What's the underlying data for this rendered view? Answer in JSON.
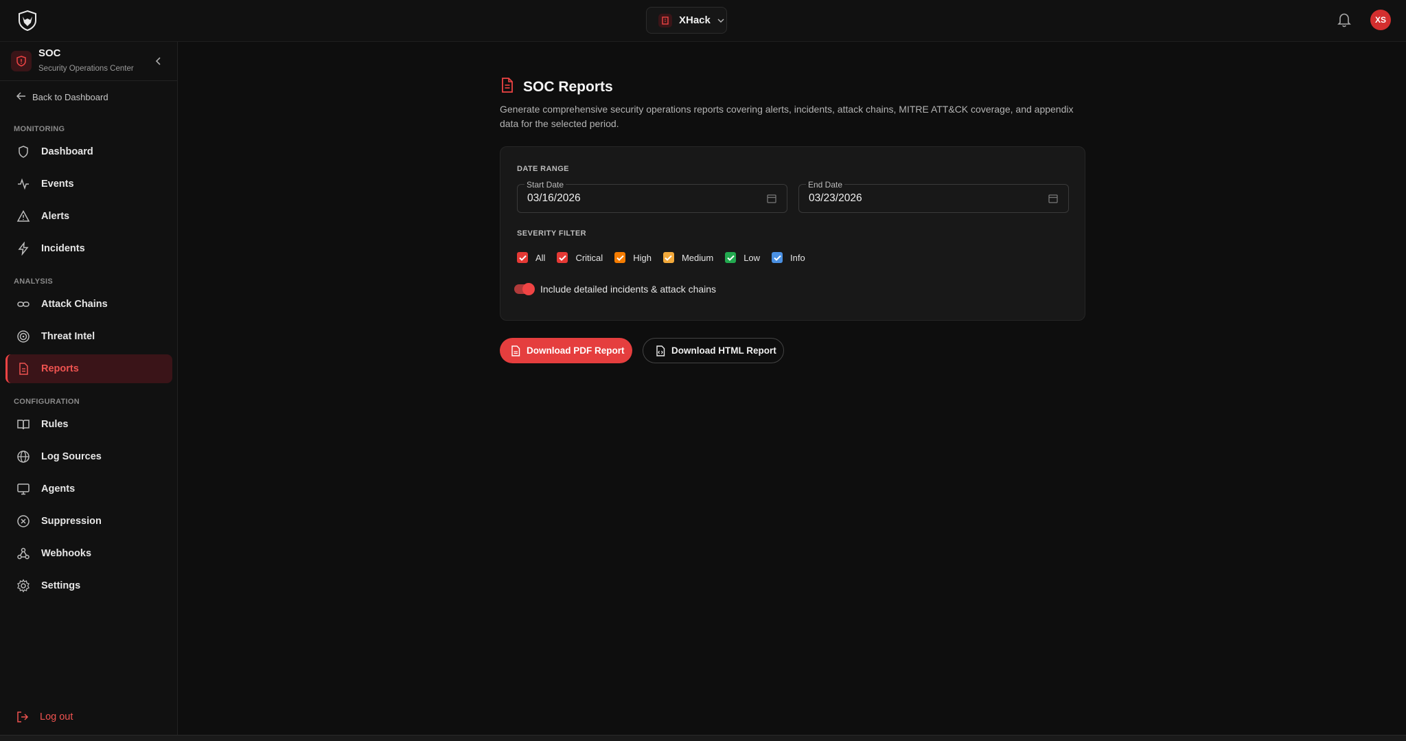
{
  "topbar": {
    "logo_icon": "wolf-shield-logo",
    "tenant_name": "XHack",
    "tenant_icon": "building-icon",
    "notification_icon": "bell-icon",
    "avatar_initials": "XS"
  },
  "sidebar": {
    "app_title": "SOC",
    "app_subtitle": "Security Operations Center",
    "back_label": "Back to Dashboard",
    "sections": [
      {
        "label": "MONITORING",
        "items": [
          {
            "label": "Dashboard",
            "icon": "shield-icon"
          },
          {
            "label": "Events",
            "icon": "activity-icon"
          },
          {
            "label": "Alerts",
            "icon": "warning-triangle-icon"
          },
          {
            "label": "Incidents",
            "icon": "lightning-icon"
          }
        ]
      },
      {
        "label": "ANALYSIS",
        "items": [
          {
            "label": "Attack Chains",
            "icon": "link-icon"
          },
          {
            "label": "Threat Intel",
            "icon": "target-icon"
          },
          {
            "label": "Reports",
            "icon": "file-text-icon",
            "active": true
          }
        ]
      },
      {
        "label": "CONFIGURATION",
        "items": [
          {
            "label": "Rules",
            "icon": "book-icon"
          },
          {
            "label": "Log Sources",
            "icon": "globe-icon"
          },
          {
            "label": "Agents",
            "icon": "monitor-icon"
          },
          {
            "label": "Suppression",
            "icon": "x-circle-icon"
          },
          {
            "label": "Webhooks",
            "icon": "webhook-icon"
          },
          {
            "label": "Settings",
            "icon": "gear-icon"
          }
        ]
      }
    ],
    "logout_label": "Log out"
  },
  "main": {
    "title": "SOC Reports",
    "description": "Generate comprehensive security operations reports covering alerts, incidents, attack chains, MITRE ATT&CK coverage, and appendix data for the selected period.",
    "date_range_label": "DATE RANGE",
    "start_date_label": "Start Date",
    "start_date_value": "03/16/2026",
    "end_date_label": "End Date",
    "end_date_value": "03/23/2026",
    "severity_label": "SEVERITY FILTER",
    "severities": [
      {
        "label": "All",
        "checked": true,
        "color": "#e53935"
      },
      {
        "label": "Critical",
        "checked": true,
        "color": "#e53935"
      },
      {
        "label": "High",
        "checked": true,
        "color": "#f57c00"
      },
      {
        "label": "Medium",
        "checked": true,
        "color": "#f2a93b"
      },
      {
        "label": "Low",
        "checked": true,
        "color": "#22a94f"
      },
      {
        "label": "Info",
        "checked": true,
        "color": "#4a90e2"
      }
    ],
    "toggle_label": "Include detailed incidents & attack chains",
    "toggle_on": true,
    "pdf_button": "Download PDF Report",
    "html_button": "Download HTML Report"
  },
  "colors": {
    "accent": "#e53e3e",
    "background": "#0e0e0e",
    "panel": "#111111"
  }
}
